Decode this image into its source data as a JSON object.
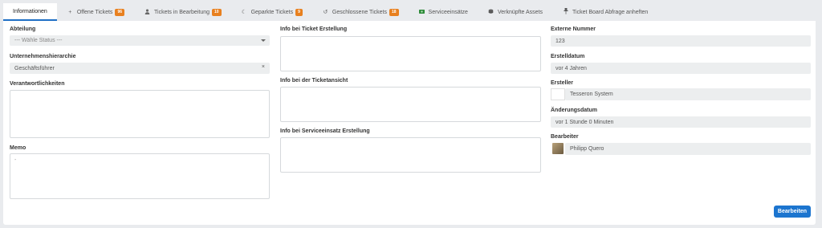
{
  "tabs": [
    {
      "label": "Informationen",
      "icon": "",
      "badge": ""
    },
    {
      "label": "Offene Tickets",
      "icon": "plus-icon",
      "badge": "96"
    },
    {
      "label": "Tickets in Bearbeitung",
      "icon": "user-icon",
      "badge": "10"
    },
    {
      "label": "Geparkte Tickets",
      "icon": "moon-icon",
      "badge": "9"
    },
    {
      "label": "Geschlossene Tickets",
      "icon": "history-icon",
      "badge": "18"
    },
    {
      "label": "Serviceeinsätze",
      "icon": "money-icon",
      "badge": ""
    },
    {
      "label": "Verknüpfte Assets",
      "icon": "database-icon",
      "badge": ""
    },
    {
      "label": "Ticket Board Abfrage anheften",
      "icon": "pin-icon",
      "badge": ""
    }
  ],
  "left": {
    "abteilung_label": "Abteilung",
    "abteilung_value": "--- Wähle Status ---",
    "hierarchie_label": "Unternehmenshierarchie",
    "hierarchie_value": "Geschäftsführer",
    "hierarchie_clear": "×",
    "verantwortlichkeiten_label": "Verantwortlichkeiten",
    "memo_label": "Memo",
    "memo_value": "-"
  },
  "middle": {
    "ticket_erstellung_label": "Info bei Ticket Erstellung",
    "ticketansicht_label": "Info bei der Ticketansicht",
    "serviceeinsatz_label": "Info bei Serviceeinsatz Erstellung"
  },
  "right": {
    "externe_nummer_label": "Externe Nummer",
    "externe_nummer_value": "123",
    "erstelldatum_label": "Erstelldatum",
    "erstelldatum_value": "vor 4 Jahren",
    "ersteller_label": "Ersteller",
    "ersteller_value": "Tesseron System",
    "aenderungsdatum_label": "Änderungsdatum",
    "aenderungsdatum_value": "vor 1 Stunde 0 Minuten",
    "bearbeiter_label": "Bearbeiter",
    "bearbeiter_value": "Philipp Quero"
  },
  "actions": {
    "edit_label": "Bearbeiten"
  },
  "colors": {
    "accent": "#1c75cf",
    "badge": "#e8801f",
    "field_bg": "#eceeef"
  }
}
